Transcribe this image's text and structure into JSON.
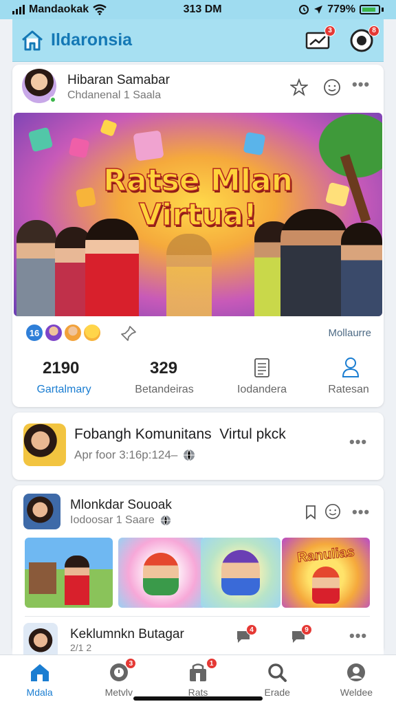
{
  "status_bar": {
    "carrier": "Mandaokak",
    "time": "313 DM",
    "battery": "779%"
  },
  "app_bar": {
    "title": "Ildaronsia",
    "notifications_badge": "3",
    "profile_badge": "8"
  },
  "post1": {
    "author": "Hibaran Samabar",
    "meta": "Chdanenal 1 Saala",
    "banner_title_line1": "Ratse Mlan",
    "banner_title_line2": "Virtua!",
    "reaction_count": "16",
    "more_link": "Mollaurre",
    "stats": [
      {
        "value": "2190",
        "label": "Gartalmary"
      },
      {
        "value": "329",
        "label": "Betandeiras"
      },
      {
        "value": "",
        "label": "Iodandera"
      },
      {
        "value": "",
        "label": "Ratesan"
      }
    ]
  },
  "post2": {
    "title": "Fobangh Komunitans  Virtul pkck",
    "meta": "Apr foor 3:16p:124–"
  },
  "post3": {
    "author": "Mlonkdar Souoak",
    "meta": "Iodoosar 1 Saare",
    "thumb4_text": "Ranulias"
  },
  "post4": {
    "author": "Keklumnkn Butagar",
    "meta": "2/1 2",
    "badge1": "4",
    "badge2": "9"
  },
  "bottom_nav": [
    {
      "label": "Mdala",
      "icon": "home-icon",
      "badge": ""
    },
    {
      "label": "Metvlv",
      "icon": "bell-icon",
      "badge": "3"
    },
    {
      "label": "Rats",
      "icon": "store-icon",
      "badge": "1"
    },
    {
      "label": "Erade",
      "icon": "search-icon",
      "badge": ""
    },
    {
      "label": "Weldee",
      "icon": "profile-icon",
      "badge": ""
    }
  ],
  "colors": {
    "accent": "#1a7dd1",
    "appbar": "#a7e0f2",
    "badge": "#e53935",
    "banner_text": "#ffd23b"
  }
}
